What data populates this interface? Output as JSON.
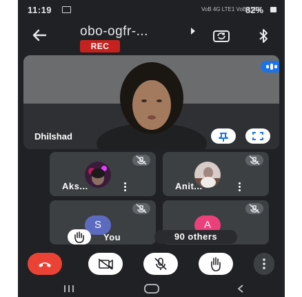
{
  "status_bar": {
    "time": "11:19",
    "network": "VoB 4G LTE1 VoB LTE2",
    "battery": "82%"
  },
  "header": {
    "meeting_code": "obo-ogfr-...",
    "rec_label": "REC"
  },
  "main_speaker": {
    "name": "Dhilshad"
  },
  "participants": [
    {
      "name": "Aks...",
      "muted": true
    },
    {
      "name": "Anit...",
      "muted": true
    },
    {
      "name": "You",
      "initial": "S",
      "muted": true,
      "hand_raised": true
    },
    {
      "name": "90 others",
      "initial": "A",
      "muted": true
    }
  ],
  "colors": {
    "background": "#202124",
    "tile": "#3c4043",
    "end_call": "#ea4335",
    "accent": "#1a73e8",
    "rec": "#c5221f",
    "self_avatar": "#5c6bc0",
    "others_avatar": "#ec407a"
  },
  "icons": [
    "back-arrow-icon",
    "switch-camera-icon",
    "bluetooth-icon",
    "pin-icon",
    "fullscreen-icon",
    "mic-off-icon",
    "more-vert-icon",
    "raise-hand-icon",
    "end-call-icon",
    "camera-off-icon",
    "recents-icon",
    "home-icon",
    "back-nav-icon"
  ]
}
